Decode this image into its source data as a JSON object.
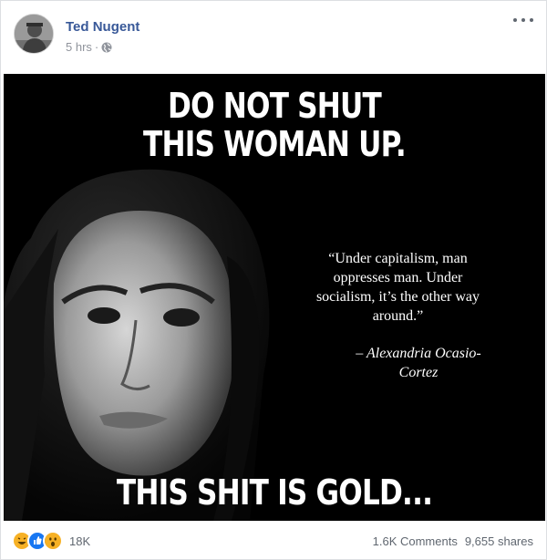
{
  "post": {
    "author": "Ted Nugent",
    "time": "5 hrs",
    "separator": "·",
    "audience_icon": "globe-icon",
    "menu_icon": "more-options-icon"
  },
  "image": {
    "headline_line1": "DO NOT SHUT",
    "headline_line2": "THIS WOMAN UP.",
    "quote_line1": "“Under capitalism, man",
    "quote_line2": "oppresses man.  Under",
    "quote_line3": "socialism, it’s the other way",
    "quote_line4": "around.”",
    "attribution_line1": "– Alexandria Ocasio-",
    "attribution_line2": "Cortez",
    "bottom_caption": "THIS SHIT IS GOLD..."
  },
  "footer": {
    "reaction_icons": [
      "haha-icon",
      "like-icon",
      "wow-icon"
    ],
    "reaction_count": "18K",
    "comments": "1.6K Comments",
    "shares": "9,655 shares"
  },
  "colors": {
    "author": "#385898",
    "meta": "#90949c",
    "like": "#1877f2",
    "haha_wow": "#f7b125"
  }
}
